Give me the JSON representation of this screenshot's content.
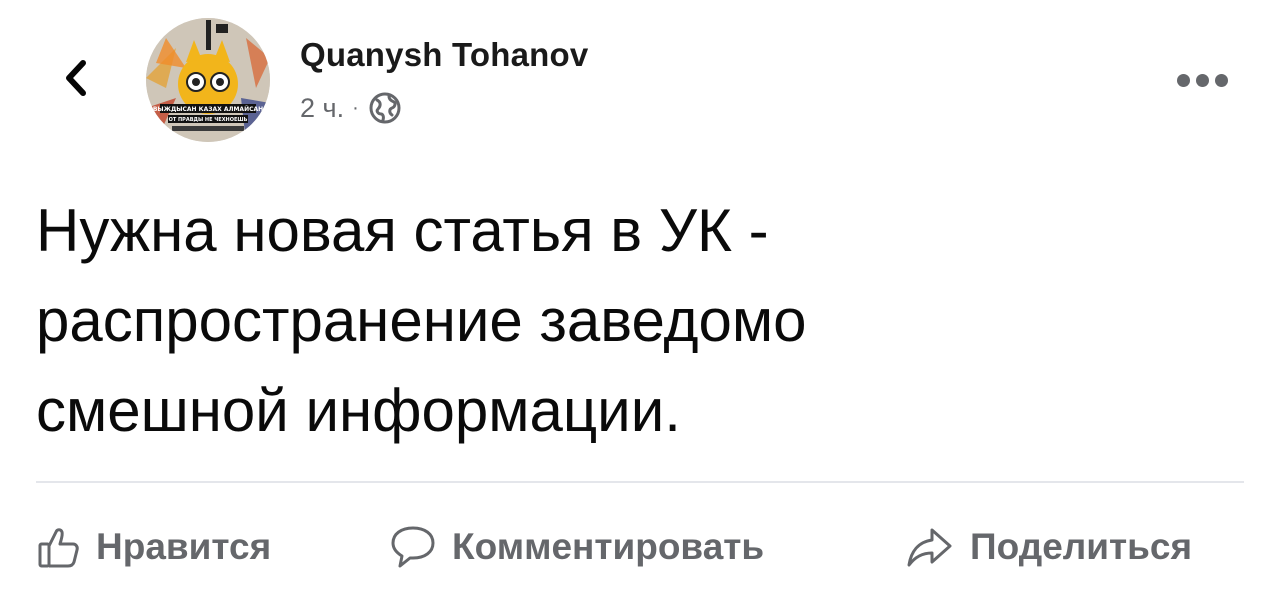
{
  "header": {
    "back_icon": "chevron-left-icon",
    "author_name": "Quanysh Tohanov",
    "timestamp": "2 ч.",
    "separator": "·",
    "privacy_icon": "globe-icon",
    "more_icon": "more-horizontal-icon",
    "avatar_caption_lines": [
      "ВЫЖДЫСАН КАЗАХ АЛМАЙСАН",
      "ОТ ПРАВДЫ НЕ ЧЕХНОЕШЬ"
    ]
  },
  "post": {
    "lines": [
      "Нужна новая статья в УК -",
      "распространение заведомо",
      "смешной информации."
    ]
  },
  "actions": {
    "like_label": "Нравится",
    "like_icon": "thumbs-up-icon",
    "comment_label": "Комментировать",
    "comment_icon": "comment-bubble-icon",
    "share_label": "Поделиться",
    "share_icon": "share-arrow-icon"
  },
  "colors": {
    "text_primary": "#050505",
    "text_secondary": "#65676b",
    "divider": "#e4e6eb",
    "avatar_accent": "#f2b51b"
  }
}
